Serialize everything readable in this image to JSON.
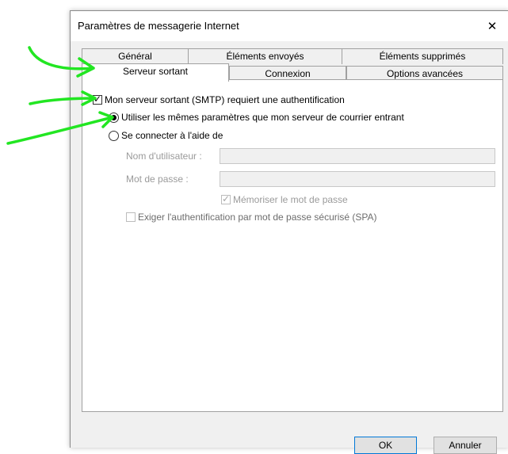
{
  "window": {
    "title": "Paramètres de messagerie Internet",
    "close_glyph": "✕"
  },
  "tabs": {
    "back": [
      "Général",
      "Éléments envoyés",
      "Éléments supprimés"
    ],
    "front": [
      "Serveur sortant",
      "Connexion",
      "Options avancées"
    ],
    "active": "Serveur sortant"
  },
  "outgoing": {
    "smtp_auth_label": "Mon serveur sortant (SMTP) requiert une authentification",
    "smtp_auth_checked": true,
    "same_settings_label": "Utiliser les mêmes paramètres que mon serveur de courrier entrant",
    "same_settings_selected": true,
    "login_with_label": "Se connecter à l'aide de",
    "username_label": "Nom d'utilisateur :",
    "username_value": "",
    "password_label": "Mot de passe :",
    "password_value": "",
    "remember_password_label": "Mémoriser le mot de passe",
    "remember_password_checked": true,
    "spa_label": "Exiger l'authentification par mot de passe sécurisé (SPA)",
    "spa_checked": false
  },
  "buttons": {
    "ok": "OK",
    "cancel": "Annuler"
  },
  "annotation": {
    "arrow_color": "#22e622"
  },
  "icons": {
    "close": "close-icon",
    "check": "checkmark-icon",
    "radio_dot": "radio-dot-icon"
  }
}
